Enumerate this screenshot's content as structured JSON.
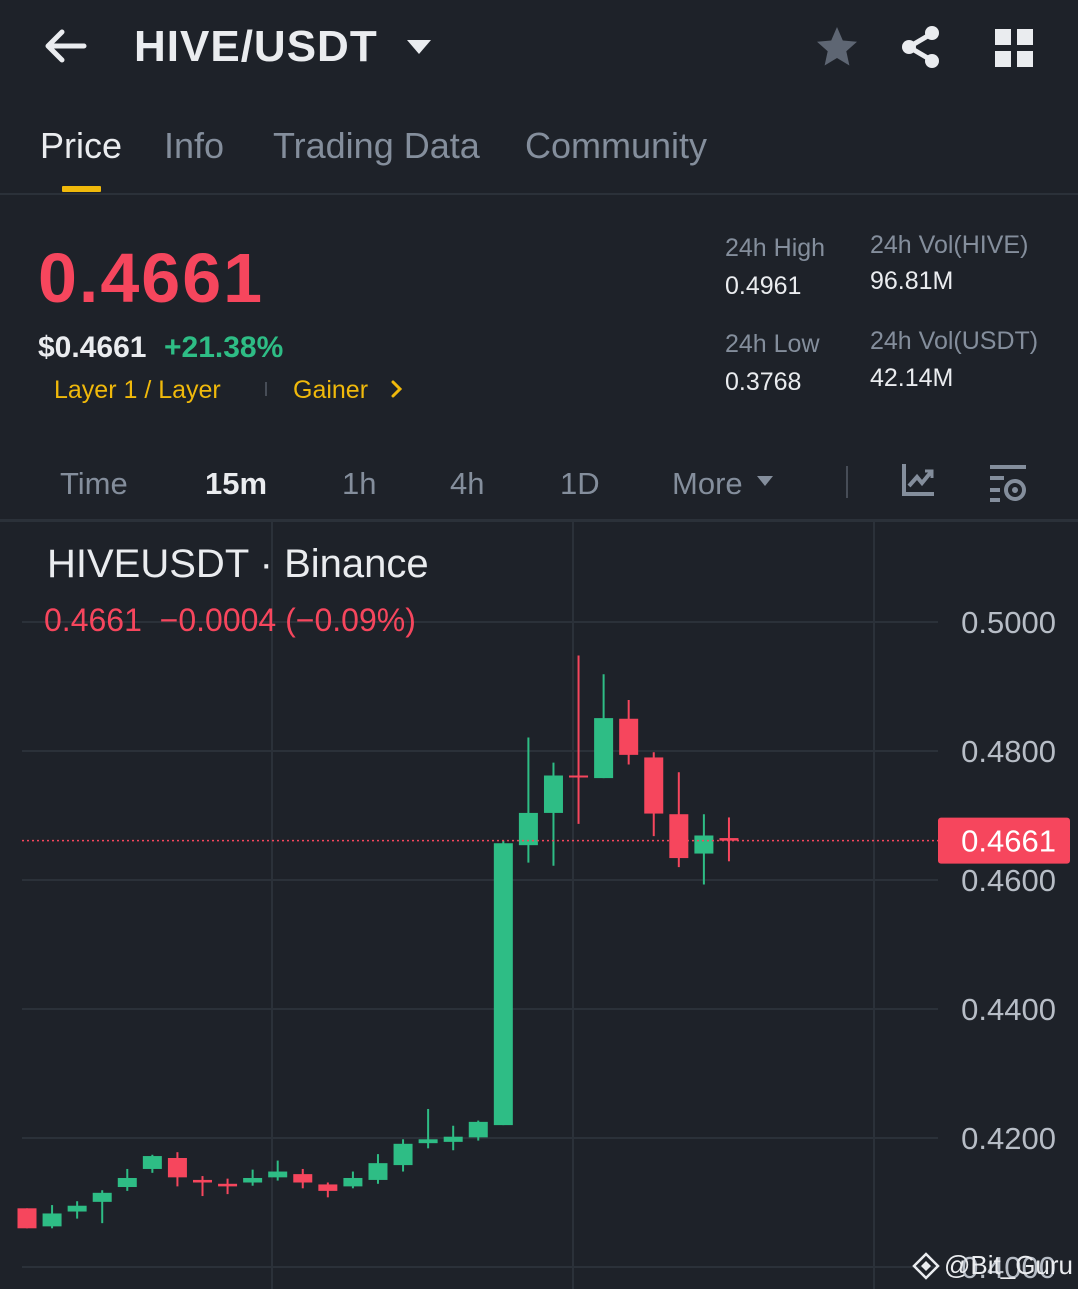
{
  "header": {
    "pair": "HIVE/USDT",
    "icons": [
      "back-arrow-icon",
      "caret-down-icon",
      "star-icon",
      "share-icon",
      "grid-icon"
    ]
  },
  "tabs": [
    {
      "label": "Price",
      "active": true
    },
    {
      "label": "Info",
      "active": false
    },
    {
      "label": "Trading Data",
      "active": false
    },
    {
      "label": "Community",
      "active": false
    }
  ],
  "ticker": {
    "last_price": "0.4661",
    "usd_price": "$0.4661",
    "change_pct": "+21.38%",
    "tags": [
      "Layer 1 / Layer",
      "Gainer"
    ],
    "stats": {
      "high_label": "24h High",
      "high_value": "0.4961",
      "low_label": "24h Low",
      "low_value": "0.3768",
      "vol_base_label": "24h Vol(HIVE)",
      "vol_base_value": "96.81M",
      "vol_quote_label": "24h Vol(USDT)",
      "vol_quote_value": "42.14M"
    }
  },
  "intervals": [
    {
      "label": "Time",
      "active": false
    },
    {
      "label": "15m",
      "active": true
    },
    {
      "label": "1h",
      "active": false
    },
    {
      "label": "4h",
      "active": false
    },
    {
      "label": "1D",
      "active": false
    },
    {
      "label": "More",
      "active": false
    }
  ],
  "chart": {
    "symbol": "HIVEUSDT · Binance",
    "change_line": "0.4661  −0.0004 (−0.09%)",
    "current_price_label": "0.4661",
    "watermark": "@Bit_Guru"
  },
  "colors": {
    "up": "#2ebd85",
    "down": "#f6465d",
    "accent": "#f0b90b",
    "background": "#1e2229"
  },
  "chart_data": {
    "type": "candlestick",
    "symbol": "HIVEUSDT",
    "interval": "15m",
    "y_ticks": [
      "0.5000",
      "0.4800",
      "0.4600",
      "0.4400",
      "0.4200",
      "0.4000"
    ],
    "ylim": [
      0.4,
      0.5
    ],
    "current_price": 0.4661,
    "candles": [
      {
        "o": 0.4091,
        "h": 0.4091,
        "l": 0.406,
        "c": 0.406
      },
      {
        "o": 0.4063,
        "h": 0.4096,
        "l": 0.406,
        "c": 0.4083
      },
      {
        "o": 0.4086,
        "h": 0.4102,
        "l": 0.4075,
        "c": 0.4095
      },
      {
        "o": 0.4101,
        "h": 0.4119,
        "l": 0.4068,
        "c": 0.4115
      },
      {
        "o": 0.4124,
        "h": 0.4152,
        "l": 0.4118,
        "c": 0.4138
      },
      {
        "o": 0.4152,
        "h": 0.4174,
        "l": 0.4146,
        "c": 0.4172
      },
      {
        "o": 0.4169,
        "h": 0.4178,
        "l": 0.4125,
        "c": 0.4139
      },
      {
        "o": 0.4135,
        "h": 0.4141,
        "l": 0.411,
        "c": 0.4131
      },
      {
        "o": 0.4129,
        "h": 0.4137,
        "l": 0.4113,
        "c": 0.4125
      },
      {
        "o": 0.4131,
        "h": 0.4151,
        "l": 0.4126,
        "c": 0.4138
      },
      {
        "o": 0.4139,
        "h": 0.4165,
        "l": 0.4134,
        "c": 0.4148
      },
      {
        "o": 0.4144,
        "h": 0.4152,
        "l": 0.4122,
        "c": 0.4131
      },
      {
        "o": 0.4128,
        "h": 0.4131,
        "l": 0.4108,
        "c": 0.4118
      },
      {
        "o": 0.4125,
        "h": 0.4148,
        "l": 0.4122,
        "c": 0.4138
      },
      {
        "o": 0.4135,
        "h": 0.4175,
        "l": 0.4129,
        "c": 0.4161
      },
      {
        "o": 0.4158,
        "h": 0.4198,
        "l": 0.4148,
        "c": 0.4191
      },
      {
        "o": 0.4192,
        "h": 0.4245,
        "l": 0.4184,
        "c": 0.4198
      },
      {
        "o": 0.4194,
        "h": 0.4219,
        "l": 0.4181,
        "c": 0.4202
      },
      {
        "o": 0.4201,
        "h": 0.4227,
        "l": 0.4196,
        "c": 0.4225
      },
      {
        "o": 0.422,
        "h": 0.4661,
        "l": 0.422,
        "c": 0.4657
      },
      {
        "o": 0.4654,
        "h": 0.4821,
        "l": 0.4627,
        "c": 0.4704
      },
      {
        "o": 0.4704,
        "h": 0.4782,
        "l": 0.4622,
        "c": 0.4762
      },
      {
        "o": 0.4762,
        "h": 0.4948,
        "l": 0.4687,
        "c": 0.4761
      },
      {
        "o": 0.4758,
        "h": 0.4919,
        "l": 0.4758,
        "c": 0.4851
      },
      {
        "o": 0.485,
        "h": 0.4879,
        "l": 0.4779,
        "c": 0.4794
      },
      {
        "o": 0.479,
        "h": 0.4798,
        "l": 0.4668,
        "c": 0.4703
      },
      {
        "o": 0.4702,
        "h": 0.4767,
        "l": 0.462,
        "c": 0.4634
      },
      {
        "o": 0.4641,
        "h": 0.4702,
        "l": 0.4593,
        "c": 0.4669
      },
      {
        "o": 0.4665,
        "h": 0.4697,
        "l": 0.4629,
        "c": 0.4661
      }
    ]
  }
}
